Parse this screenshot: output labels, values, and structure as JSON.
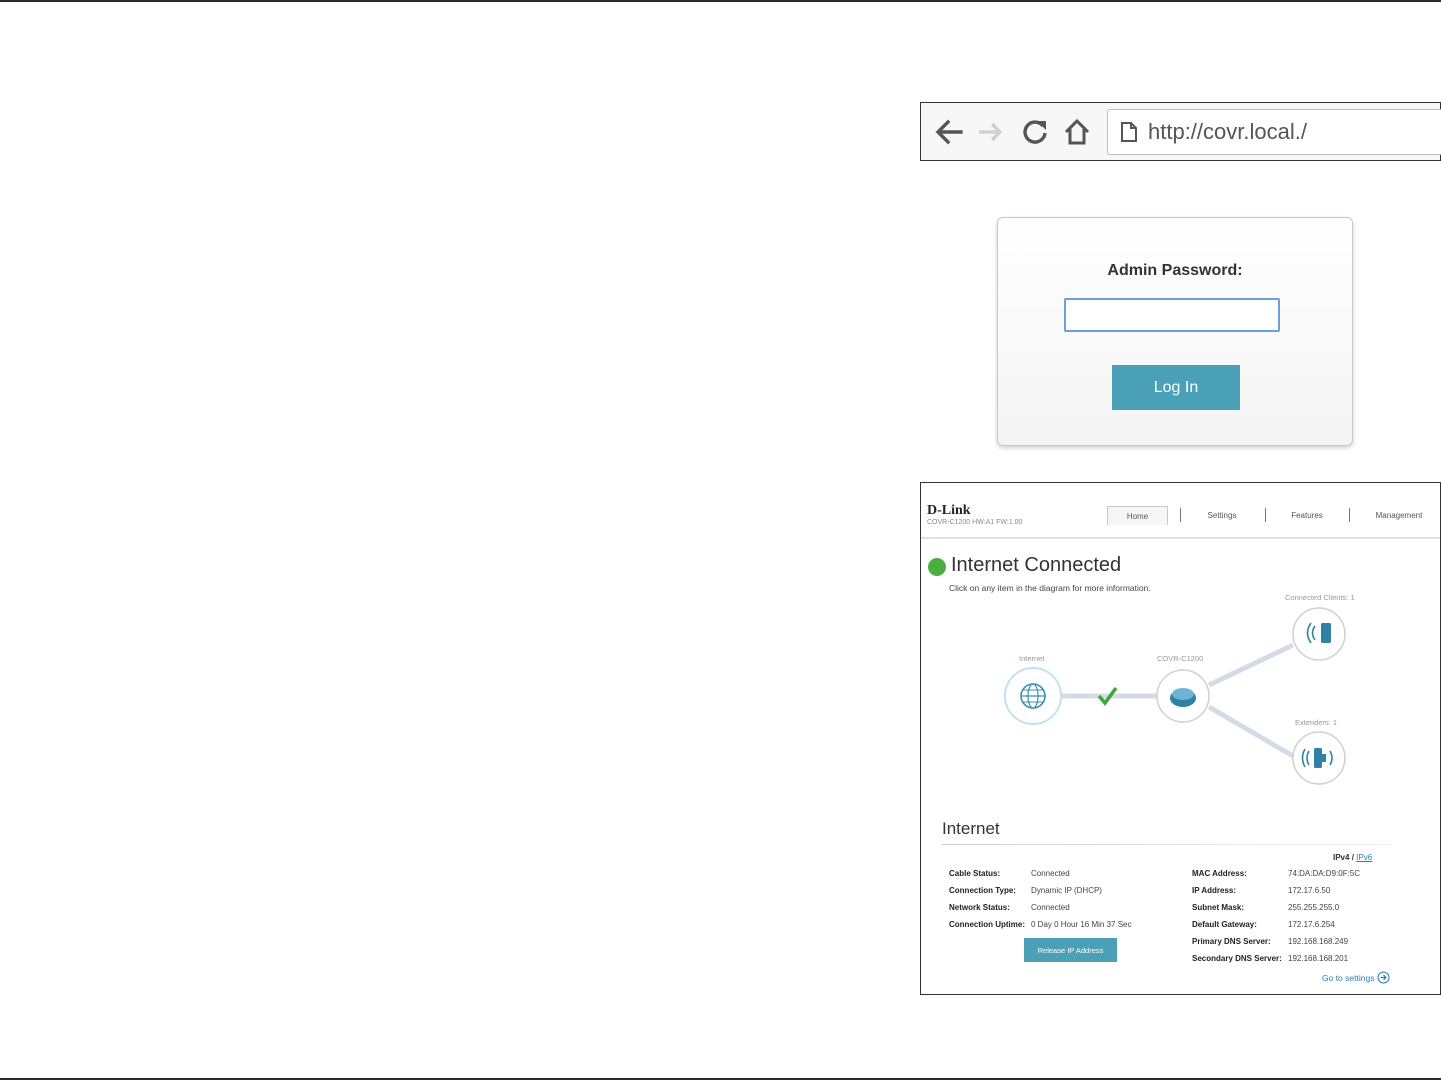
{
  "browser": {
    "url": "http://covr.local./"
  },
  "login": {
    "label": "Admin Password:",
    "password_value": "",
    "button_label": "Log In"
  },
  "dashboard": {
    "brand": "D-Link",
    "model_line": "COVR-C1200 HW:A1 FW:1.00",
    "tabs": [
      {
        "label": "Home"
      },
      {
        "label": "Settings"
      },
      {
        "label": "Features"
      },
      {
        "label": "Management"
      }
    ],
    "status_title": "Internet Connected",
    "status_subtitle": "Click on any item in the diagram for more information.",
    "diagram": {
      "internet_label": "Internet",
      "router_label": "COVR-C1200",
      "clients_label": "Connected Clients: 1",
      "extenders_label": "Extenders: 1"
    },
    "section_title": "Internet",
    "ip_switch": {
      "ipv4": "IPv4",
      "sep": "/",
      "ipv6": "IPv6"
    },
    "left_info": [
      {
        "key": "Cable Status:",
        "value": "Connected"
      },
      {
        "key": "Connection Type:",
        "value": "Dynamic IP (DHCP)"
      },
      {
        "key": "Network Status:",
        "value": "Connected"
      },
      {
        "key": "Connection Uptime:",
        "value": "0 Day 0 Hour 16 Min 37 Sec"
      }
    ],
    "right_info": [
      {
        "key": "MAC Address:",
        "value": "74:DA:DA:D9:0F:5C"
      },
      {
        "key": "IP Address:",
        "value": "172.17.6.50"
      },
      {
        "key": "Subnet Mask:",
        "value": "255.255.255.0"
      },
      {
        "key": "Default Gateway:",
        "value": "172.17.6.254"
      },
      {
        "key": "Primary DNS Server:",
        "value": "192.168.168.249"
      },
      {
        "key": "Secondary DNS Server:",
        "value": "192.168.168.201"
      }
    ],
    "release_button": "Release IP Address",
    "goto_settings": "Go to settings",
    "colors": {
      "accent": "#4aa0b6",
      "connected": "#4cae3f",
      "link": "#2a7db5"
    }
  }
}
